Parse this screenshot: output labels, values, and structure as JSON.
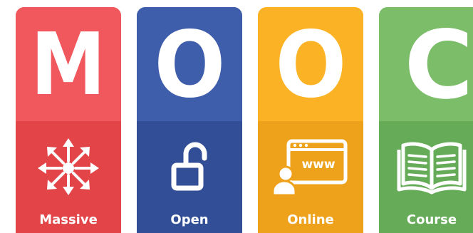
{
  "cards": [
    {
      "letter": "M",
      "label": "Massive",
      "icon": "network-arrows-icon",
      "top_color": "#f0585d",
      "bottom_color": "#e24448"
    },
    {
      "letter": "O",
      "label": "Open",
      "icon": "unlocked-padlock-icon",
      "top_color": "#3e5daa",
      "bottom_color": "#324e96"
    },
    {
      "letter": "O",
      "label": "Online",
      "icon": "user-web-browser-icon",
      "top_color": "#fbb325",
      "bottom_color": "#eea21c"
    },
    {
      "letter": "C",
      "label": "Course",
      "icon": "open-book-icon",
      "top_color": "#7cbd6a",
      "bottom_color": "#66ac58"
    }
  ],
  "icon_text": {
    "www": "www"
  }
}
